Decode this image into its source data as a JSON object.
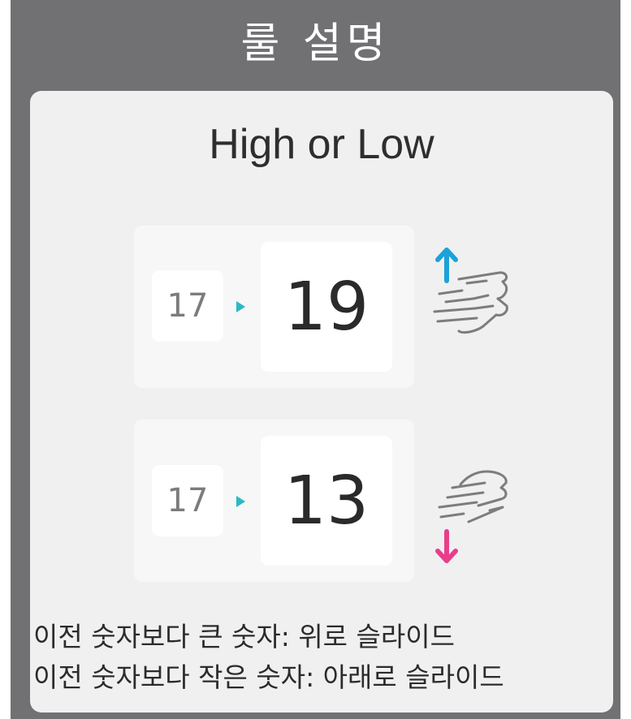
{
  "header": {
    "title": "룰 설명"
  },
  "card": {
    "game_title": "High or Low",
    "examples": [
      {
        "previous": "17",
        "next": "19",
        "direction": "up",
        "arrow_color": "#1aa3d8",
        "gesture_icon": "swipe-up-hand-icon"
      },
      {
        "previous": "17",
        "next": "13",
        "direction": "down",
        "arrow_color": "#e83e8c",
        "gesture_icon": "swipe-down-hand-icon"
      }
    ],
    "rules": [
      "이전 숫자보다 큰 숫자: 위로 슬라이드",
      "이전 숫자보다 작은 숫자: 아래로 슬라이드"
    ]
  },
  "colors": {
    "background": "#717073",
    "card": "#f0f0f0",
    "pointer": "#2bb8c2"
  }
}
